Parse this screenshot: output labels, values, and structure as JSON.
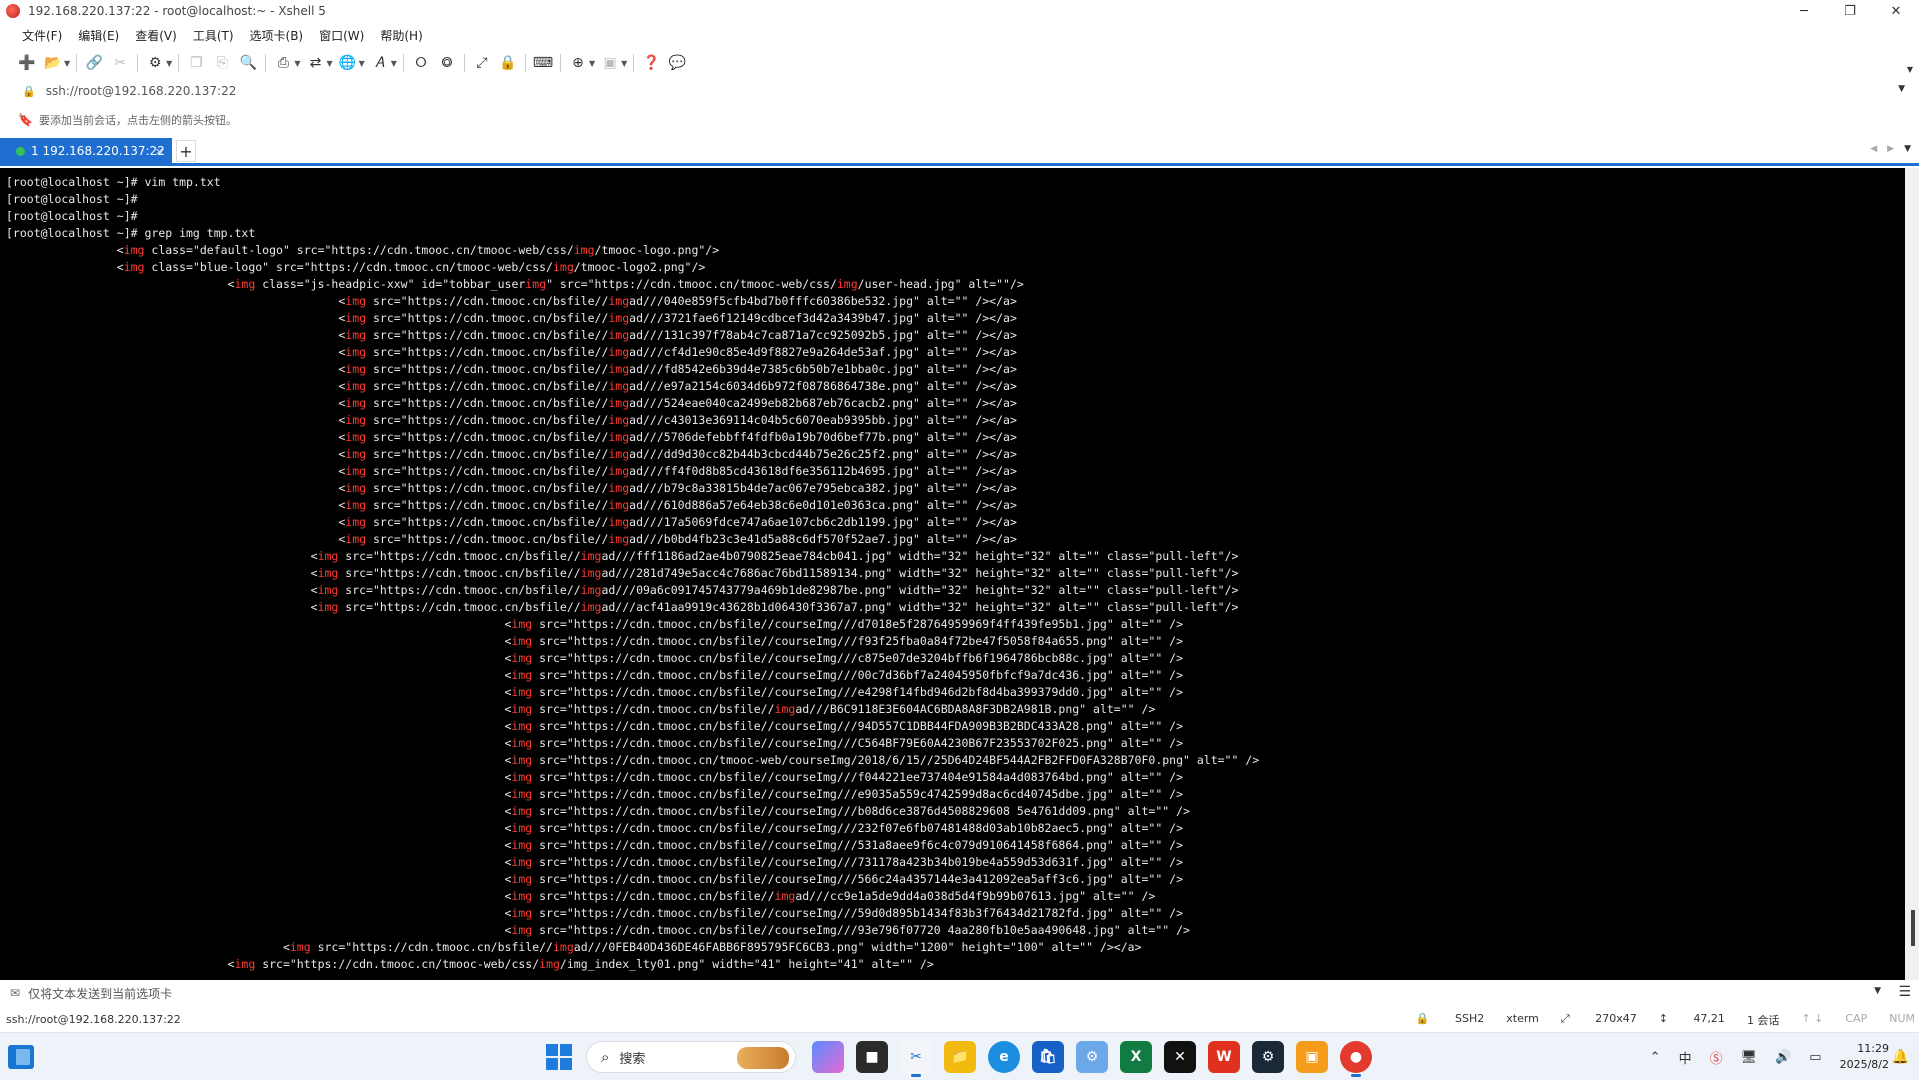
{
  "window": {
    "title": "192.168.220.137:22 - root@localhost:~ - Xshell 5",
    "minimize": "─",
    "maximize": "❐",
    "close": "✕"
  },
  "menu": [
    "文件(F)",
    "编辑(E)",
    "查看(V)",
    "工具(T)",
    "选项卡(B)",
    "窗口(W)",
    "帮助(H)"
  ],
  "address": {
    "value": "ssh://root@192.168.220.137:22"
  },
  "hint": {
    "text": "要添加当前会话，点击左侧的箭头按钮。"
  },
  "tabs": [
    {
      "label": "1 192.168.220.137:22",
      "close": "×"
    }
  ],
  "tab_add": "+",
  "terminal": {
    "lines": [
      [
        {
          "t": "[root@localhost ~]# vim tmp.txt"
        }
      ],
      [
        {
          "t": "[root@localhost ~]#"
        }
      ],
      [
        {
          "t": "[root@localhost ~]#"
        }
      ],
      [
        {
          "t": "[root@localhost ~]# grep img tmp.txt"
        }
      ],
      [
        {
          "t": "                <"
        },
        {
          "t": "img",
          "k": 1
        },
        {
          "t": " class=\"default-logo\" src=\"https://cdn.tmooc.cn/tmooc-web/css/"
        },
        {
          "t": "img",
          "k": 1
        },
        {
          "t": "/tmooc-logo.png\"/>"
        }
      ],
      [
        {
          "t": "                <"
        },
        {
          "t": "img",
          "k": 1
        },
        {
          "t": " class=\"blue-logo\" src=\"https://cdn.tmooc.cn/tmooc-web/css/"
        },
        {
          "t": "img",
          "k": 1
        },
        {
          "t": "/tmooc-logo2.png\"/>"
        }
      ],
      [
        {
          "t": "                                <"
        },
        {
          "t": "img",
          "k": 1
        },
        {
          "t": " class=\"js-headpic-xxw\" id=\"tobbar_user"
        },
        {
          "t": "img",
          "k": 1
        },
        {
          "t": "\" src=\"https://cdn.tmooc.cn/tmooc-web/css/"
        },
        {
          "t": "img",
          "k": 1
        },
        {
          "t": "/user-head.jpg\" alt=\"\"/>"
        }
      ],
      [
        {
          "t": "                                                <"
        },
        {
          "t": "img",
          "k": 1
        },
        {
          "t": " src=\"https://cdn.tmooc.cn/bsfile//"
        },
        {
          "t": "img",
          "k": 1
        },
        {
          "t": "ad///040e859f5cfb4bd7b0fffc60386be532.jpg\" alt=\"\" /></a>"
        }
      ],
      [
        {
          "t": "                                                <"
        },
        {
          "t": "img",
          "k": 1
        },
        {
          "t": " src=\"https://cdn.tmooc.cn/bsfile//"
        },
        {
          "t": "img",
          "k": 1
        },
        {
          "t": "ad///3721fae6f12149cdbcef3d42a3439b47.jpg\" alt=\"\" /></a>"
        }
      ],
      [
        {
          "t": "                                                <"
        },
        {
          "t": "img",
          "k": 1
        },
        {
          "t": " src=\"https://cdn.tmooc.cn/bsfile//"
        },
        {
          "t": "img",
          "k": 1
        },
        {
          "t": "ad///131c397f78ab4c7ca871a7cc925092b5.jpg\" alt=\"\" /></a>"
        }
      ],
      [
        {
          "t": "                                                <"
        },
        {
          "t": "img",
          "k": 1
        },
        {
          "t": " src=\"https://cdn.tmooc.cn/bsfile//"
        },
        {
          "t": "img",
          "k": 1
        },
        {
          "t": "ad///cf4d1e90c85e4d9f8827e9a264de53af.jpg\" alt=\"\" /></a>"
        }
      ],
      [
        {
          "t": "                                                <"
        },
        {
          "t": "img",
          "k": 1
        },
        {
          "t": " src=\"https://cdn.tmooc.cn/bsfile//"
        },
        {
          "t": "img",
          "k": 1
        },
        {
          "t": "ad///fd8542e6b39d4e7385c6b50b7e1bba0c.jpg\" alt=\"\" /></a>"
        }
      ],
      [
        {
          "t": "                                                <"
        },
        {
          "t": "img",
          "k": 1
        },
        {
          "t": " src=\"https://cdn.tmooc.cn/bsfile//"
        },
        {
          "t": "img",
          "k": 1
        },
        {
          "t": "ad///e97a2154c6034d6b972f08786864738e.png\" alt=\"\" /></a>"
        }
      ],
      [
        {
          "t": "                                                <"
        },
        {
          "t": "img",
          "k": 1
        },
        {
          "t": " src=\"https://cdn.tmooc.cn/bsfile//"
        },
        {
          "t": "img",
          "k": 1
        },
        {
          "t": "ad///524eae040ca2499eb82b687eb76cacb2.png\" alt=\"\" /></a>"
        }
      ],
      [
        {
          "t": "                                                <"
        },
        {
          "t": "img",
          "k": 1
        },
        {
          "t": " src=\"https://cdn.tmooc.cn/bsfile//"
        },
        {
          "t": "img",
          "k": 1
        },
        {
          "t": "ad///c43013e369114c04b5c6070eab9395bb.jpg\" alt=\"\" /></a>"
        }
      ],
      [
        {
          "t": "                                                <"
        },
        {
          "t": "img",
          "k": 1
        },
        {
          "t": " src=\"https://cdn.tmooc.cn/bsfile//"
        },
        {
          "t": "img",
          "k": 1
        },
        {
          "t": "ad///5706defebbff4fdfb0a19b70d6bef77b.png\" alt=\"\" /></a>"
        }
      ],
      [
        {
          "t": "                                                <"
        },
        {
          "t": "img",
          "k": 1
        },
        {
          "t": " src=\"https://cdn.tmooc.cn/bsfile//"
        },
        {
          "t": "img",
          "k": 1
        },
        {
          "t": "ad///dd9d30cc82b44b3cbcd44b75e26c25f2.png\" alt=\"\" /></a>"
        }
      ],
      [
        {
          "t": "                                                <"
        },
        {
          "t": "img",
          "k": 1
        },
        {
          "t": " src=\"https://cdn.tmooc.cn/bsfile//"
        },
        {
          "t": "img",
          "k": 1
        },
        {
          "t": "ad///ff4f0d8b85cd43618df6e356112b4695.jpg\" alt=\"\" /></a>"
        }
      ],
      [
        {
          "t": "                                                <"
        },
        {
          "t": "img",
          "k": 1
        },
        {
          "t": " src=\"https://cdn.tmooc.cn/bsfile//"
        },
        {
          "t": "img",
          "k": 1
        },
        {
          "t": "ad///b79c8a33815b4de7ac067e795ebca382.jpg\" alt=\"\" /></a>"
        }
      ],
      [
        {
          "t": "                                                <"
        },
        {
          "t": "img",
          "k": 1
        },
        {
          "t": " src=\"https://cdn.tmooc.cn/bsfile//"
        },
        {
          "t": "img",
          "k": 1
        },
        {
          "t": "ad///610d886a57e64eb38c6e0d101e0363ca.png\" alt=\"\" /></a>"
        }
      ],
      [
        {
          "t": "                                                <"
        },
        {
          "t": "img",
          "k": 1
        },
        {
          "t": " src=\"https://cdn.tmooc.cn/bsfile//"
        },
        {
          "t": "img",
          "k": 1
        },
        {
          "t": "ad///17a5069fdce747a6ae107cb6c2db1199.jpg\" alt=\"\" /></a>"
        }
      ],
      [
        {
          "t": "                                                <"
        },
        {
          "t": "img",
          "k": 1
        },
        {
          "t": " src=\"https://cdn.tmooc.cn/bsfile//"
        },
        {
          "t": "img",
          "k": 1
        },
        {
          "t": "ad///b0bd4fb23c3e41d5a88c6df570f52ae7.jpg\" alt=\"\" /></a>"
        }
      ],
      [
        {
          "t": "                                            <"
        },
        {
          "t": "img",
          "k": 1
        },
        {
          "t": " src=\"https://cdn.tmooc.cn/bsfile//"
        },
        {
          "t": "img",
          "k": 1
        },
        {
          "t": "ad///fff1186ad2ae4b0790825eae784cb041.jpg\" width=\"32\" height=\"32\" alt=\"\" class=\"pull-left\"/>"
        }
      ],
      [
        {
          "t": "                                            <"
        },
        {
          "t": "img",
          "k": 1
        },
        {
          "t": " src=\"https://cdn.tmooc.cn/bsfile//"
        },
        {
          "t": "img",
          "k": 1
        },
        {
          "t": "ad///281d749e5acc4c7686ac76bd11589134.png\" width=\"32\" height=\"32\" alt=\"\" class=\"pull-left\"/>"
        }
      ],
      [
        {
          "t": "                                            <"
        },
        {
          "t": "img",
          "k": 1
        },
        {
          "t": " src=\"https://cdn.tmooc.cn/bsfile//"
        },
        {
          "t": "img",
          "k": 1
        },
        {
          "t": "ad///09a6c091745743779a469b1de82987be.png\" width=\"32\" height=\"32\" alt=\"\" class=\"pull-left\"/>"
        }
      ],
      [
        {
          "t": "                                            <"
        },
        {
          "t": "img",
          "k": 1
        },
        {
          "t": " src=\"https://cdn.tmooc.cn/bsfile//"
        },
        {
          "t": "img",
          "k": 1
        },
        {
          "t": "ad///acf41aa9919c43628b1d06430f3367a7.png\" width=\"32\" height=\"32\" alt=\"\" class=\"pull-left\"/>"
        }
      ],
      [
        {
          "t": "                                                                        <"
        },
        {
          "t": "img",
          "k": 1
        },
        {
          "t": " src=\"https://cdn.tmooc.cn/bsfile//courseImg///d7018e5f28764959969f4ff439fe95b1.jpg\" alt=\"\" />"
        }
      ],
      [
        {
          "t": "                                                                        <"
        },
        {
          "t": "img",
          "k": 1
        },
        {
          "t": " src=\"https://cdn.tmooc.cn/bsfile//courseImg///f93f25fba0a84f72be47f5058f84a655.png\" alt=\"\" />"
        }
      ],
      [
        {
          "t": "                                                                        <"
        },
        {
          "t": "img",
          "k": 1
        },
        {
          "t": " src=\"https://cdn.tmooc.cn/bsfile//courseImg///c875e07de3204bffb6f1964786bcb88c.jpg\" alt=\"\" />"
        }
      ],
      [
        {
          "t": "                                                                        <"
        },
        {
          "t": "img",
          "k": 1
        },
        {
          "t": " src=\"https://cdn.tmooc.cn/bsfile//courseImg///00c7d36bf7a24045950fbfcf9a7dc436.jpg\" alt=\"\" />"
        }
      ],
      [
        {
          "t": "                                                                        <"
        },
        {
          "t": "img",
          "k": 1
        },
        {
          "t": " src=\"https://cdn.tmooc.cn/bsfile//courseImg///e4298f14fbd946d2bf8d4ba399379dd0.jpg\" alt=\"\" />"
        }
      ],
      [
        {
          "t": "                                                                        <"
        },
        {
          "t": "img",
          "k": 1
        },
        {
          "t": " src=\"https://cdn.tmooc.cn/bsfile//"
        },
        {
          "t": "img",
          "k": 1
        },
        {
          "t": "ad///B6C9118E3E604AC6BDA8A8F3DB2A981B.png\" alt=\"\" />"
        }
      ],
      [
        {
          "t": "                                                                        <"
        },
        {
          "t": "img",
          "k": 1
        },
        {
          "t": " src=\"https://cdn.tmooc.cn/bsfile//courseImg///94D557C1DBB44FDA909B3B2BDC433A28.png\" alt=\"\" />"
        }
      ],
      [
        {
          "t": "                                                                        <"
        },
        {
          "t": "img",
          "k": 1
        },
        {
          "t": " src=\"https://cdn.tmooc.cn/bsfile//courseImg///C564BF79E60A4230B67F23553702F025.png\" alt=\"\" />"
        }
      ],
      [
        {
          "t": "                                                                        <"
        },
        {
          "t": "img",
          "k": 1
        },
        {
          "t": " src=\"https://cdn.tmooc.cn/tmooc-web/courseImg/2018/6/15//25D64D24BF544A2FB2FFD0FA328B70F0.png\" alt=\"\" />"
        }
      ],
      [
        {
          "t": "                                                                        <"
        },
        {
          "t": "img",
          "k": 1
        },
        {
          "t": " src=\"https://cdn.tmooc.cn/bsfile//courseImg///f044221ee737404e91584a4d083764bd.png\" alt=\"\" />"
        }
      ],
      [
        {
          "t": "                                                                        <"
        },
        {
          "t": "img",
          "k": 1
        },
        {
          "t": " src=\"https://cdn.tmooc.cn/bsfile//courseImg///e9035a559c4742599d8ac6cd40745dbe.jpg\" alt=\"\" />"
        }
      ],
      [
        {
          "t": "                                                                        <"
        },
        {
          "t": "img",
          "k": 1
        },
        {
          "t": " src=\"https://cdn.tmooc.cn/bsfile//courseImg///b08d6ce3876d4508829608 5e4761dd09.png\" alt=\"\" />"
        }
      ],
      [
        {
          "t": "                                                                        <"
        },
        {
          "t": "img",
          "k": 1
        },
        {
          "t": " src=\"https://cdn.tmooc.cn/bsfile//courseImg///232f07e6fb07481488d03ab10b82aec5.png\" alt=\"\" />"
        }
      ],
      [
        {
          "t": "                                                                        <"
        },
        {
          "t": "img",
          "k": 1
        },
        {
          "t": " src=\"https://cdn.tmooc.cn/bsfile//courseImg///531a8aee9f6c4c079d910641458f6864.png\" alt=\"\" />"
        }
      ],
      [
        {
          "t": "                                                                        <"
        },
        {
          "t": "img",
          "k": 1
        },
        {
          "t": " src=\"https://cdn.tmooc.cn/bsfile//courseImg///731178a423b34b019be4a559d53d631f.jpg\" alt=\"\" />"
        }
      ],
      [
        {
          "t": "                                                                        <"
        },
        {
          "t": "img",
          "k": 1
        },
        {
          "t": " src=\"https://cdn.tmooc.cn/bsfile//courseImg///566c24a4357144e3a412092ea5aff3c6.jpg\" alt=\"\" />"
        }
      ],
      [
        {
          "t": "                                                                        <"
        },
        {
          "t": "img",
          "k": 1
        },
        {
          "t": " src=\"https://cdn.tmooc.cn/bsfile//"
        },
        {
          "t": "img",
          "k": 1
        },
        {
          "t": "ad///cc9e1a5de9dd4a038d5d4f9b99b07613.jpg\" alt=\"\" />"
        }
      ],
      [
        {
          "t": "                                                                        <"
        },
        {
          "t": "img",
          "k": 1
        },
        {
          "t": " src=\"https://cdn.tmooc.cn/bsfile//courseImg///59d0d895b1434f83b3f76434d21782fd.jpg\" alt=\"\" />"
        }
      ],
      [
        {
          "t": "                                                                        <"
        },
        {
          "t": "img",
          "k": 1
        },
        {
          "t": " src=\"https://cdn.tmooc.cn/bsfile//courseImg///93e796f07720 4aa280fb10e5aa490648.jpg\" alt=\"\" />"
        }
      ],
      [
        {
          "t": "                                        <"
        },
        {
          "t": "img",
          "k": 1
        },
        {
          "t": " src=\"https://cdn.tmooc.cn/bsfile//"
        },
        {
          "t": "img",
          "k": 1
        },
        {
          "t": "ad///0FEB40D436DE46FABB6F895795FC6CB3.png\" width=\"1200\" height=\"100\" alt=\"\" /></a>"
        }
      ],
      [
        {
          "t": "                                <"
        },
        {
          "t": "img",
          "k": 1
        },
        {
          "t": " src=\"https://cdn.tmooc.cn/tmooc-web/css/"
        },
        {
          "t": "img",
          "k": 1
        },
        {
          "t": "/img_index_lty01.png\" width=\"41\" height=\"41\" alt=\"\" />"
        }
      ]
    ]
  },
  "sendbar": {
    "text": "仅将文本发送到当前选项卡"
  },
  "status": {
    "left": "ssh://root@192.168.220.137:22",
    "protocol": "SSH2",
    "term": "xterm",
    "size": "270x47",
    "cursor": "47,21",
    "sessions": "1 会话",
    "cap": "CAP",
    "num": "NUM"
  },
  "taskbar": {
    "search_label": "搜索",
    "time": "11:29",
    "date": "2025/8/2"
  },
  "colors": {
    "accent": "#1f6fd1",
    "terminal_bg": "#000000",
    "terminal_fg": "#e8e8e8",
    "highlight": "#ff3b30"
  }
}
